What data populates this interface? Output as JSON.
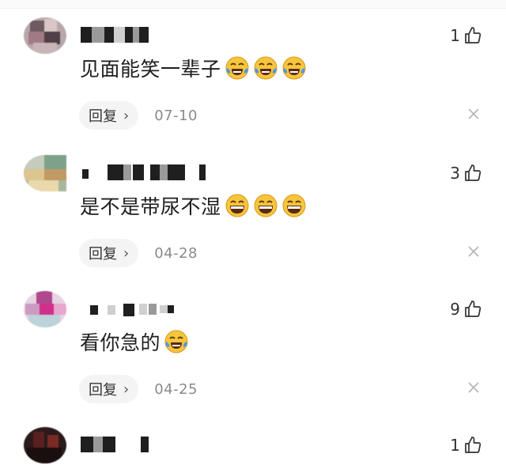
{
  "comments": [
    {
      "likes": "1",
      "text": "见面能笑一辈子",
      "emoji": "crying-laughing",
      "emoji_count": 3,
      "reply_label": "回复",
      "date": "07-10"
    },
    {
      "likes": "3",
      "text": "是不是带尿不湿",
      "emoji": "grinning",
      "emoji_count": 3,
      "reply_label": "回复",
      "date": "04-28"
    },
    {
      "likes": "9",
      "text": "看你急的",
      "emoji": "crying-laughing",
      "emoji_count": 1,
      "reply_label": "回复",
      "date": "04-25"
    },
    {
      "likes": "1"
    }
  ],
  "icons": {
    "like": "thumbs-up-icon",
    "close": "close-icon",
    "reply_chevron": "chevron-right-icon"
  },
  "colors": {
    "reply_bg": "#f4f4f4",
    "date": "#8a8a8a",
    "emoji_face": "#f7c53c",
    "emoji_tear": "#4a9be8"
  }
}
